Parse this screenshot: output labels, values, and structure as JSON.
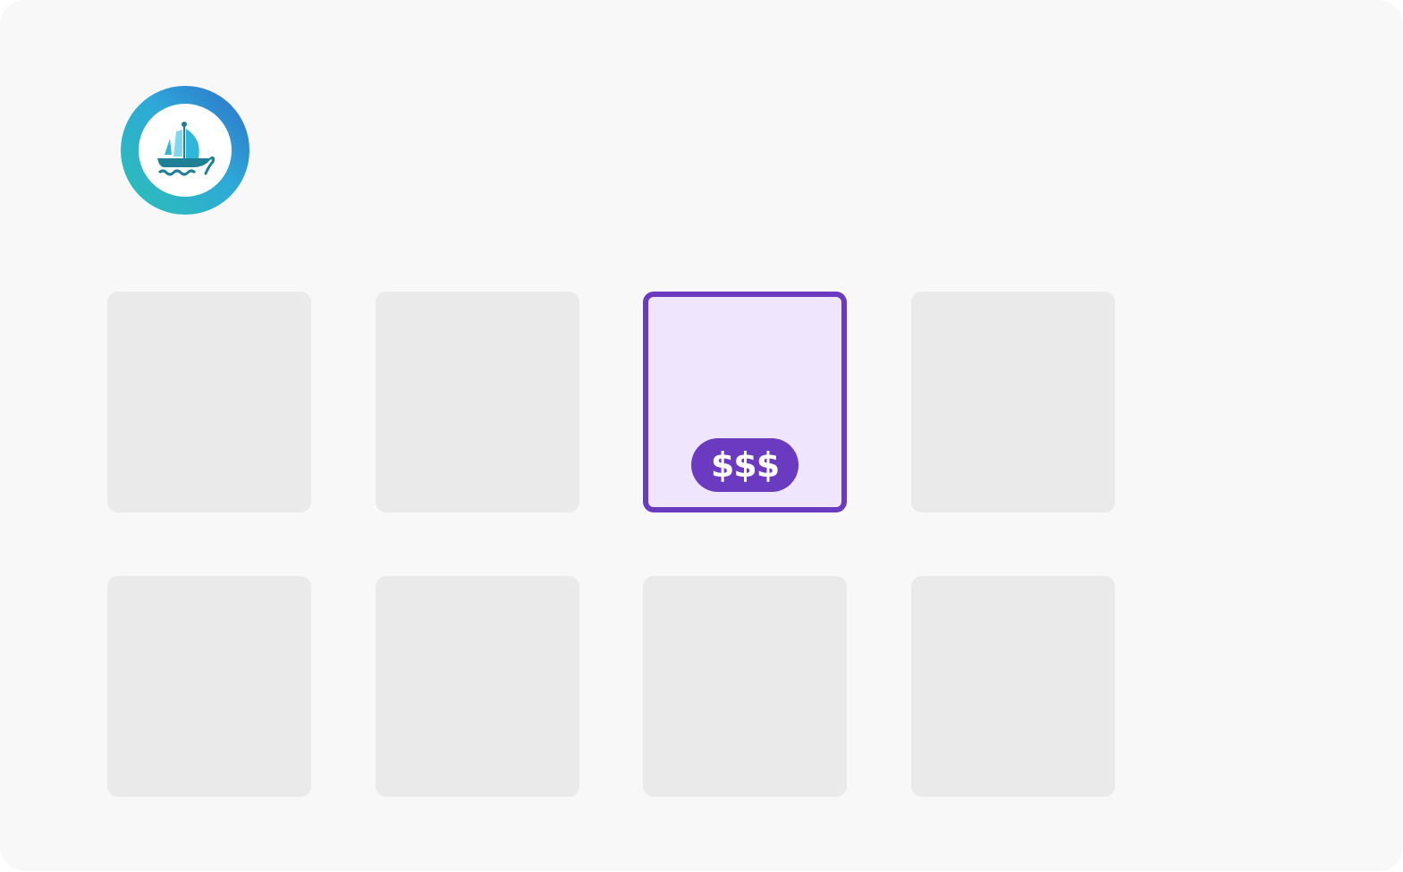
{
  "logo": {
    "icon": "ship-logo-icon",
    "colors": {
      "ring_start": "#2cc0b4",
      "ring_end": "#2f7fe0",
      "sail": "#3cc6e8",
      "hull": "#1f7f94"
    }
  },
  "grid": {
    "rows": 2,
    "columns": 4,
    "selected_index": 2,
    "tile_color": "#eaeaea",
    "selected_fill": "#efe5fc",
    "accent": "#6a3ac0",
    "selected_badge": "$$$"
  }
}
